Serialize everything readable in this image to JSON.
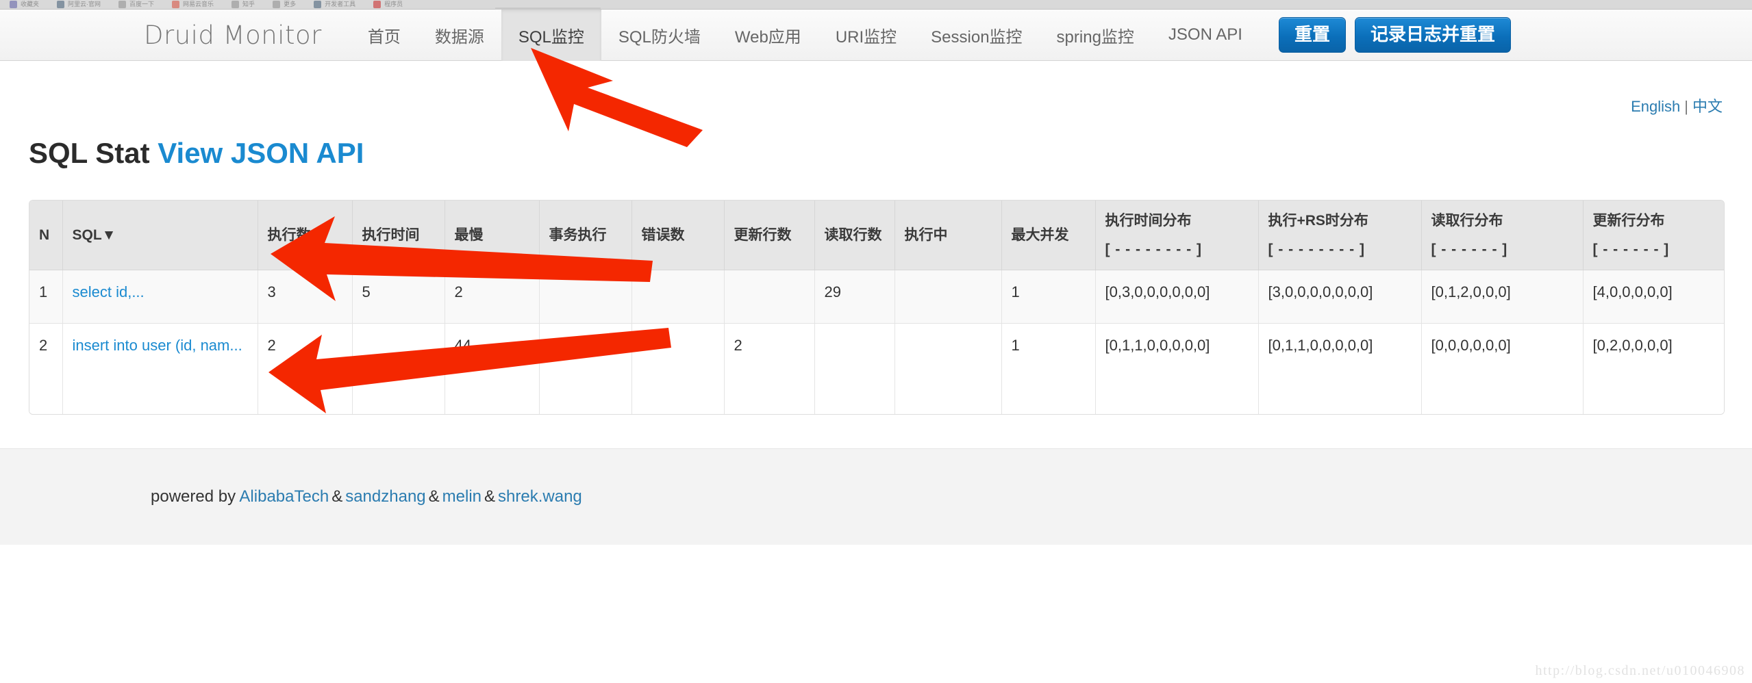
{
  "browser": {
    "bookmarks": [
      {
        "label": "收藏夹",
        "color": "#5b5ba5"
      },
      {
        "label": "阿里云·官网",
        "color": "#3f5b75"
      },
      {
        "label": "百度一下",
        "color": "#8b8b8b"
      },
      {
        "label": "网易云音乐",
        "color": "#d84a38"
      },
      {
        "label": "知乎",
        "color": "#8b8b8b"
      },
      {
        "label": "更多",
        "color": "#8b8b8b"
      },
      {
        "label": "开发者工具",
        "color": "#3f5b75"
      },
      {
        "label": "程序员",
        "color": "#cc2222"
      }
    ]
  },
  "navbar": {
    "brand": "Druid Monitor",
    "items": [
      {
        "label": "首页",
        "name": "nav-home",
        "active": false
      },
      {
        "label": "数据源",
        "name": "nav-datasource",
        "active": false
      },
      {
        "label": "SQL监控",
        "name": "nav-sql-monitor",
        "active": true
      },
      {
        "label": "SQL防火墙",
        "name": "nav-sql-firewall",
        "active": false
      },
      {
        "label": "Web应用",
        "name": "nav-web-app",
        "active": false
      },
      {
        "label": "URI监控",
        "name": "nav-uri-monitor",
        "active": false
      },
      {
        "label": "Session监控",
        "name": "nav-session-monitor",
        "active": false
      },
      {
        "label": "spring监控",
        "name": "nav-spring-monitor",
        "active": false
      },
      {
        "label": "JSON API",
        "name": "nav-json-api",
        "active": false
      }
    ],
    "buttons": {
      "reset": "重置",
      "log_and_reset": "记录日志并重置"
    },
    "accent_color": "#0b6fba"
  },
  "lang": {
    "english": "English",
    "separator": "|",
    "chinese": "中文"
  },
  "title": {
    "main": "SQL Stat",
    "link": "View JSON API"
  },
  "table": {
    "columns": [
      {
        "key": "n",
        "label": "N",
        "bracket": "",
        "name": "col-n"
      },
      {
        "key": "sql",
        "label": "SQL▼",
        "bracket": "",
        "name": "col-sql"
      },
      {
        "key": "exec",
        "label": "执行数",
        "bracket": "",
        "name": "col-exec-count"
      },
      {
        "key": "time",
        "label": "执行时间",
        "bracket": "",
        "name": "col-exec-time"
      },
      {
        "key": "slow",
        "label": "最慢",
        "bracket": "",
        "name": "col-slowest"
      },
      {
        "key": "tx",
        "label": "事务执行",
        "bracket": "",
        "name": "col-transaction"
      },
      {
        "key": "err",
        "label": "错误数",
        "bracket": "",
        "name": "col-error-count"
      },
      {
        "key": "upd",
        "label": "更新行数",
        "bracket": "",
        "name": "col-update-rows"
      },
      {
        "key": "read",
        "label": "读取行数",
        "bracket": "",
        "name": "col-read-rows"
      },
      {
        "key": "run",
        "label": "执行中",
        "bracket": "",
        "name": "col-running"
      },
      {
        "key": "conc",
        "label": "最大并发",
        "bracket": "",
        "name": "col-max-concurrent"
      },
      {
        "key": "d1",
        "label": "执行时间分布",
        "bracket": "[ - - - - - - - - ]",
        "name": "col-exec-time-histogram"
      },
      {
        "key": "d2",
        "label": "执行+RS时分布",
        "bracket": "[ - - - - - - - - ]",
        "name": "col-exec-rs-histogram"
      },
      {
        "key": "d3",
        "label": "读取行分布",
        "bracket": "[ - - - - - - ]",
        "name": "col-read-rows-histogram"
      },
      {
        "key": "d4",
        "label": "更新行分布",
        "bracket": "[ - - - - - - ]",
        "name": "col-update-rows-histogram"
      }
    ],
    "rows": [
      {
        "n": "1",
        "sql": "select id,...",
        "exec": "3",
        "time": "5",
        "slow": "2",
        "tx": "",
        "err": "",
        "upd": "",
        "read": "29",
        "run": "",
        "conc": "1",
        "d1": "[0,3,0,0,0,0,0,0]",
        "d2": "[3,0,0,0,0,0,0,0]",
        "d3": "[0,1,2,0,0,0]",
        "d4": "[4,0,0,0,0,0]"
      },
      {
        "n": "2",
        "sql": "insert into user (id, nam...",
        "exec": "2",
        "time": "",
        "slow": "44",
        "tx": "",
        "err": "",
        "upd": "2",
        "read": "",
        "run": "",
        "conc": "1",
        "d1": "[0,1,1,0,0,0,0,0]",
        "d2": "[0,1,1,0,0,0,0,0]",
        "d3": "[0,0,0,0,0,0]",
        "d4": "[0,2,0,0,0,0]"
      }
    ]
  },
  "footer": {
    "prefix": "powered by",
    "links": [
      "AlibabaTech",
      "sandzhang",
      "melin",
      "shrek.wang"
    ],
    "separator": "&"
  },
  "watermark": "http://blog.csdn.net/u010046908",
  "annotations": {
    "arrow_color": "#f42700",
    "count": 3
  }
}
